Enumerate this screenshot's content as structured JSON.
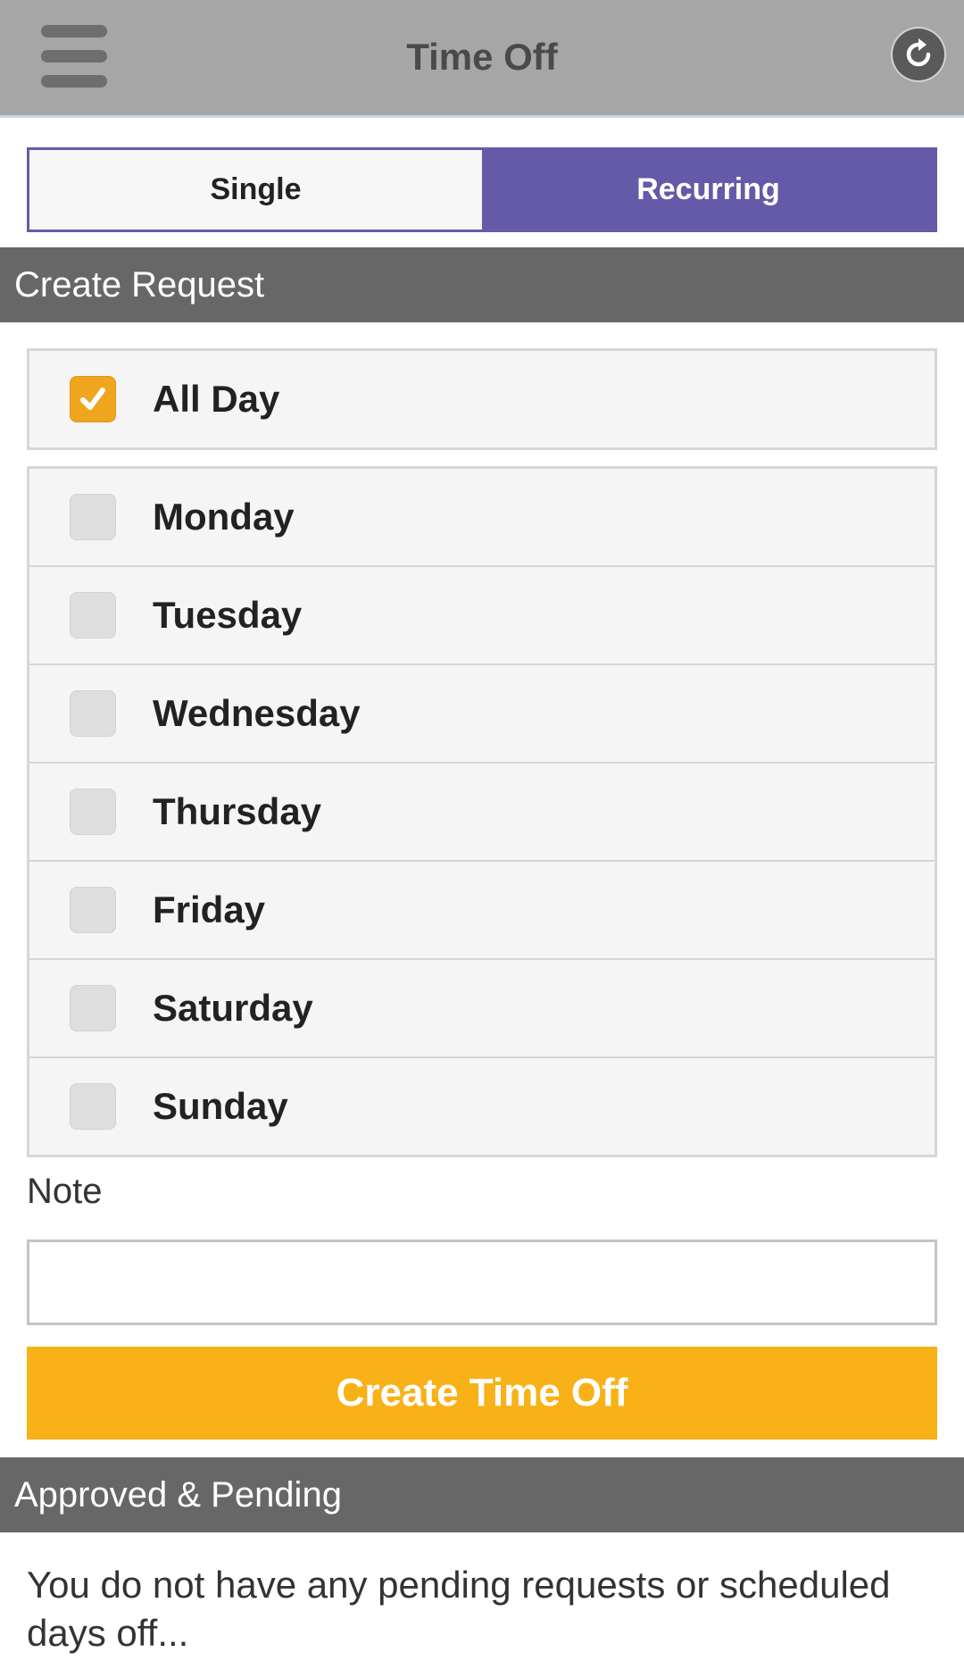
{
  "header": {
    "title": "Time Off",
    "menu_icon": "hamburger-menu-icon",
    "refresh_icon": "refresh-icon"
  },
  "segmented": {
    "single_label": "Single",
    "recurring_label": "Recurring",
    "selected": "Recurring"
  },
  "create_request": {
    "section_title": "Create Request",
    "all_day": {
      "label": "All Day",
      "checked": true
    },
    "days": [
      {
        "label": "Monday",
        "checked": false
      },
      {
        "label": "Tuesday",
        "checked": false
      },
      {
        "label": "Wednesday",
        "checked": false
      },
      {
        "label": "Thursday",
        "checked": false
      },
      {
        "label": "Friday",
        "checked": false
      },
      {
        "label": "Saturday",
        "checked": false
      },
      {
        "label": "Sunday",
        "checked": false
      }
    ],
    "note_label": "Note",
    "note_value": "",
    "submit_label": "Create Time Off"
  },
  "approved_pending": {
    "section_title": "Approved & Pending",
    "empty_message": "You do not have any pending requests or scheduled days off..."
  },
  "colors": {
    "header_bg": "#a6a6a6",
    "accent_purple": "#645aa8",
    "accent_orange": "#f9b118",
    "checkbox_checked": "#f0a51e",
    "section_bg": "#676767"
  }
}
